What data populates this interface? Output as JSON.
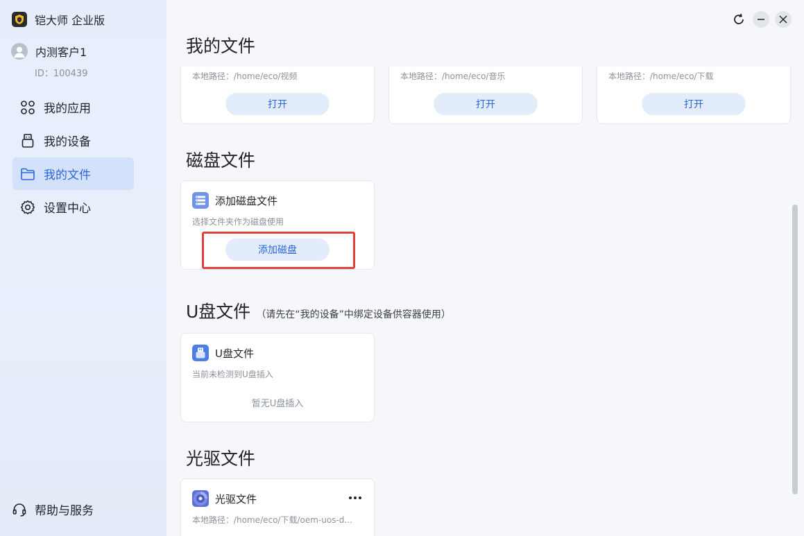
{
  "app": {
    "title": "铠大师 企业版"
  },
  "user": {
    "name": "内测客户1",
    "id": "ID：100439"
  },
  "nav": {
    "items": [
      {
        "label": "我的应用",
        "icon": "apps-icon"
      },
      {
        "label": "我的设备",
        "icon": "device-icon"
      },
      {
        "label": "我的文件",
        "icon": "folder-icon",
        "active": true
      },
      {
        "label": "设置中心",
        "icon": "gear-icon"
      }
    ],
    "help": "帮助与服务"
  },
  "window_controls": [
    "refresh-icon",
    "minimize-icon",
    "close-icon"
  ],
  "my_files": {
    "title": "我的文件",
    "cards": [
      {
        "path": "本地路径：/home/eco/视频",
        "button": "打开"
      },
      {
        "path": "本地路径：/home/eco/音乐",
        "button": "打开"
      },
      {
        "path": "本地路径：/home/eco/下载",
        "button": "打开"
      }
    ]
  },
  "disk_files": {
    "title": "磁盘文件",
    "card": {
      "title": "添加磁盘文件",
      "desc": "选择文件夹作为磁盘使用",
      "button": "添加磁盘"
    }
  },
  "usb_files": {
    "title": "U盘文件",
    "subtitle": "（请先在“我的设备”中绑定设备供容器使用）",
    "card": {
      "title": "U盘文件",
      "desc": "当前未检测到U盘插入",
      "empty": "暂无U盘插入"
    }
  },
  "optical_files": {
    "title": "光驱文件",
    "card": {
      "title": "光驱文件",
      "desc": "本地路径：/home/eco/下载/oem-uos-d..."
    }
  },
  "colors": {
    "accent": "#2b66d9",
    "button_bg": "#e3ecfb",
    "active_nav": "#d4e1fa",
    "highlight": "#e0403b"
  }
}
